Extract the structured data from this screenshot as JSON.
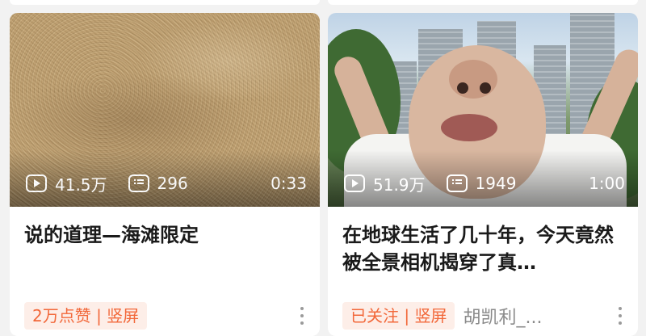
{
  "cards": [
    {
      "plays": "41.5万",
      "danmaku": "296",
      "duration": "0:33",
      "title": "说的道理—海滩限定",
      "tag": "2万点赞 | 竖屏",
      "author": ""
    },
    {
      "plays": "51.9万",
      "danmaku": "1949",
      "duration": "1:00",
      "title": "在地球生活了几十年，今天竟然被全景相机揭穿了真…",
      "tag": "已关注 | 竖屏",
      "author": "胡凯利_..."
    }
  ],
  "icons": {
    "play": "play-count-icon",
    "danmaku": "danmaku-icon",
    "more": "more-vertical-icon"
  },
  "colors": {
    "accent": "#f2683a",
    "tag_bg": "#fdeee8",
    "background": "#f2f2f2"
  }
}
